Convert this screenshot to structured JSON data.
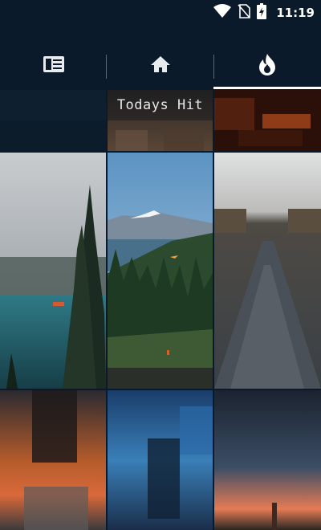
{
  "status_bar": {
    "time": "11:19",
    "icons": [
      "wifi-icon",
      "no-sim-icon",
      "battery-charging-icon"
    ]
  },
  "tabs": [
    {
      "name": "feed",
      "icon": "article-icon",
      "selected": false
    },
    {
      "name": "home",
      "icon": "home-icon",
      "selected": false
    },
    {
      "name": "hot",
      "icon": "flame-icon",
      "selected": true
    }
  ],
  "gallery": {
    "caption": "Todays Hit",
    "tiles": [
      {
        "subject": "dark-header-tile"
      },
      {
        "subject": "todays-hit-tile"
      },
      {
        "subject": "red-city-lights"
      },
      {
        "subject": "misty-lake-forest"
      },
      {
        "subject": "mountain-paraglider-valley"
      },
      {
        "subject": "blurred-road-vanishing"
      },
      {
        "subject": "sunset-silhouette-blur"
      },
      {
        "subject": "blue-night-blur"
      },
      {
        "subject": "sunset-horizon-gradient"
      }
    ]
  },
  "colors": {
    "appbar": "#0b1a2a",
    "indicator": "#ffffff",
    "icon": "#e9ecef"
  }
}
